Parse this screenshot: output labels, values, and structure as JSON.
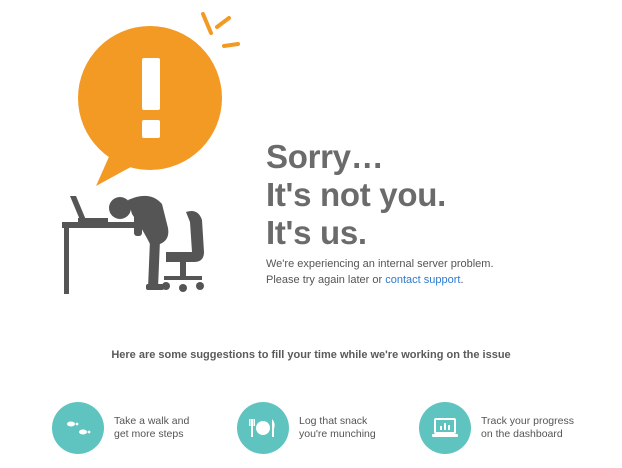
{
  "hero": {
    "headline": [
      "Sorry…",
      "It's not you.",
      "It's us."
    ],
    "message_line1": "We're experiencing an internal server problem.",
    "message_line2_prefix": "Please try again later or ",
    "contact_link": "contact support",
    "message_line2_suffix": "."
  },
  "illustration": {
    "bubble_symbol": "!",
    "accent_color": "#f39a24",
    "figure_color": "#555555"
  },
  "suggestions": {
    "heading": "Here are some suggestions to fill your time while we're working on the issue",
    "items": [
      {
        "icon": "footsteps-icon",
        "line1": "Take a walk and",
        "line2": "get more steps"
      },
      {
        "icon": "fork-plate-knife-icon",
        "line1": "Log that snack",
        "line2": "you're munching"
      },
      {
        "icon": "laptop-chart-icon",
        "line1": "Track your progress",
        "line2": "on the dashboard"
      }
    ],
    "icon_color": "#5fc4c0"
  }
}
